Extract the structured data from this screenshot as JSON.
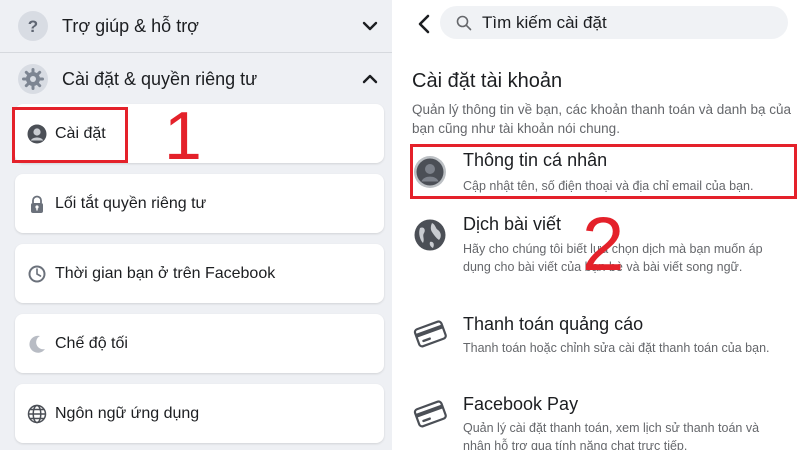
{
  "left": {
    "menu": [
      {
        "label": "Trợ giúp & hỗ trợ",
        "icon": "question-icon",
        "expanded": false
      },
      {
        "label": "Cài đặt & quyền riêng tư",
        "icon": "gear-icon",
        "expanded": true
      }
    ],
    "cards": [
      {
        "label": "Cài đặt",
        "icon": "profile-icon"
      },
      {
        "label": "Lối tắt quyền riêng tư",
        "icon": "lock-icon"
      },
      {
        "label": "Thời gian bạn ở trên Facebook",
        "icon": "clock-icon"
      },
      {
        "label": "Chế độ tối",
        "icon": "moon-icon"
      },
      {
        "label": "Ngôn ngữ ứng dụng",
        "icon": "globe-icon"
      }
    ],
    "step_number": "1"
  },
  "right": {
    "search": {
      "placeholder": "Tìm kiếm cài đặt"
    },
    "section": {
      "title": "Cài đặt tài khoản",
      "description": "Quản lý thông tin về bạn, các khoản thanh toán và danh bạ của bạn cũng như tài khoản nói chung."
    },
    "items": [
      {
        "title": "Thông tin cá nhân",
        "description": "Cập nhật tên, số điện thoại và địa chỉ email của bạn.",
        "icon": "profile-icon"
      },
      {
        "title": "Dịch bài viết",
        "description": "Hãy cho chúng tôi biết lựa chọn dịch mà bạn muốn áp dụng cho bài viết của bạn bè và bài viết song ngữ.",
        "icon": "globe-icon"
      },
      {
        "title": "Thanh toán quảng cáo",
        "description": "Thanh toán hoặc chỉnh sửa cài đặt thanh toán của bạn.",
        "icon": "credit-card-icon"
      },
      {
        "title": "Facebook Pay",
        "description": "Quản lý cài đặt thanh toán, xem lịch sử thanh toán và nhận hỗ trợ qua tính năng chat trực tiếp.",
        "icon": "credit-card-icon"
      }
    ],
    "step_number": "2"
  },
  "colors": {
    "highlight": "#e4212a",
    "panel_bg": "#eef0f4",
    "card_bg": "#ffffff",
    "secondary_text": "#65676b"
  }
}
